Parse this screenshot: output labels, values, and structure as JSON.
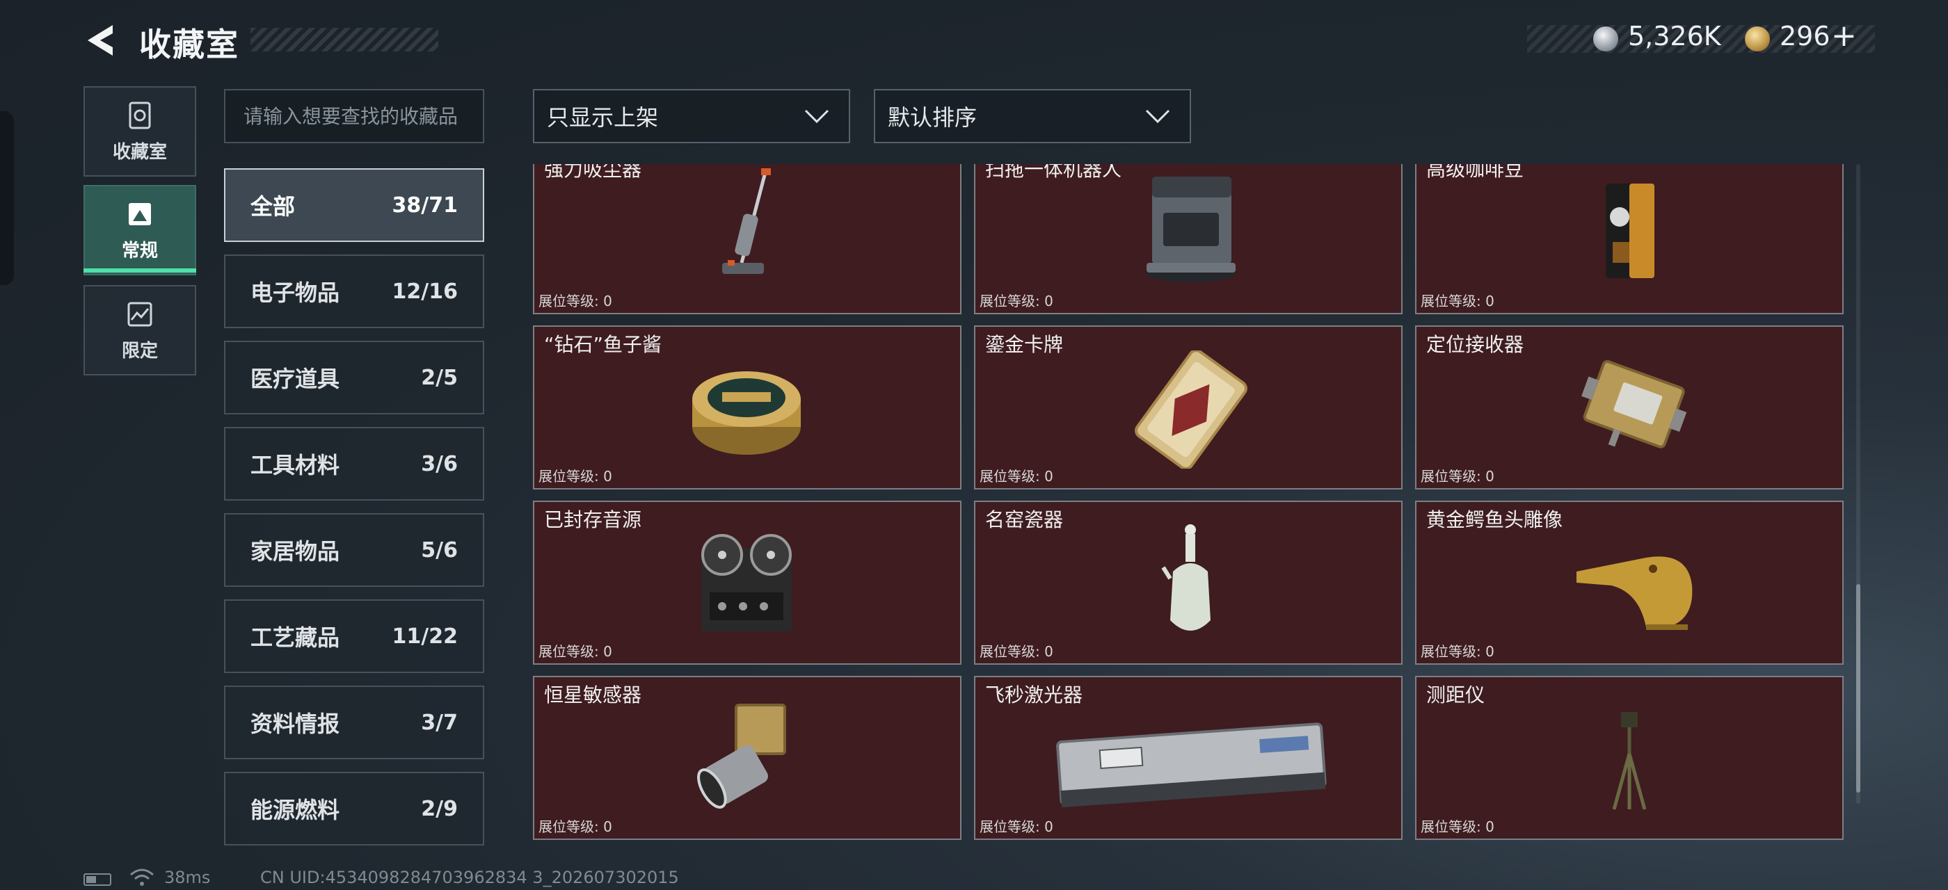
{
  "header": {
    "title": "收藏室",
    "currency_silver": "5,326K",
    "currency_gold": "296",
    "plus_label": "+"
  },
  "side_tabs": [
    {
      "label": "收藏室",
      "icon": "vault-icon"
    },
    {
      "label": "常规",
      "icon": "gallery-icon"
    },
    {
      "label": "限定",
      "icon": "frame-icon"
    }
  ],
  "search": {
    "placeholder": "请输入想要查找的收藏品"
  },
  "filters": {
    "show_filter": "只显示上架",
    "sort": "默认排序"
  },
  "categories": [
    {
      "name": "全部",
      "count": "38/71"
    },
    {
      "name": "电子物品",
      "count": "12/16"
    },
    {
      "name": "医疗道具",
      "count": "2/5"
    },
    {
      "name": "工具材料",
      "count": "3/6"
    },
    {
      "name": "家居物品",
      "count": "5/6"
    },
    {
      "name": "工艺藏品",
      "count": "11/22"
    },
    {
      "name": "资料情报",
      "count": "3/7"
    },
    {
      "name": "能源燃料",
      "count": "2/9"
    }
  ],
  "items": [
    {
      "name": "强力吸尘器",
      "level": "展位等级: 0",
      "icon": "vacuum-cleaner-icon"
    },
    {
      "name": "扫拖一体机器人",
      "level": "展位等级: 0",
      "icon": "robot-mop-icon"
    },
    {
      "name": "高级咖啡豆",
      "level": "展位等级: 0",
      "icon": "coffee-bag-icon"
    },
    {
      "name": "“钻石”鱼子酱",
      "level": "展位等级: 0",
      "icon": "caviar-tin-icon"
    },
    {
      "name": "鎏金卡牌",
      "level": "展位等级: 0",
      "icon": "gold-card-icon"
    },
    {
      "name": "定位接收器",
      "level": "展位等级: 0",
      "icon": "gps-receiver-icon"
    },
    {
      "name": "已封存音源",
      "level": "展位等级: 0",
      "icon": "reel-recorder-icon"
    },
    {
      "name": "名窑瓷器",
      "level": "展位等级: 0",
      "icon": "porcelain-vase-icon"
    },
    {
      "name": "黄金鳄鱼头雕像",
      "level": "展位等级: 0",
      "icon": "crocodile-head-icon"
    },
    {
      "name": "恒星敏感器",
      "level": "展位等级: 0",
      "icon": "star-sensor-icon"
    },
    {
      "name": "飞秒激光器",
      "level": "展位等级: 0",
      "icon": "laser-box-icon"
    },
    {
      "name": "测距仪",
      "level": "展位等级: 0",
      "icon": "rangefinder-icon"
    }
  ],
  "status_bar": {
    "ping": "38ms",
    "uid": "CN UID:4534098284703962834 3_202607302015"
  }
}
